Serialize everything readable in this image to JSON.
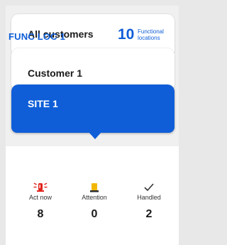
{
  "nav": {
    "all_customers": "All customers",
    "customer": "Customer 1",
    "site": "SITE 1"
  },
  "functional": {
    "title": "FUNC LOC 1",
    "count": "10",
    "count_label_line1": "Functional",
    "count_label_line2": "locations"
  },
  "metrics": [
    {
      "label": "Act now",
      "value": "8",
      "icon": "alarm-siren-icon"
    },
    {
      "label": "Attention",
      "value": "0",
      "icon": "warning-light-icon"
    },
    {
      "label": "Handled",
      "value": "2",
      "icon": "checkmark-icon"
    }
  ],
  "colors": {
    "accent": "#0f5ed8",
    "alarm": "#e0231b",
    "attention": "#f2b705"
  }
}
